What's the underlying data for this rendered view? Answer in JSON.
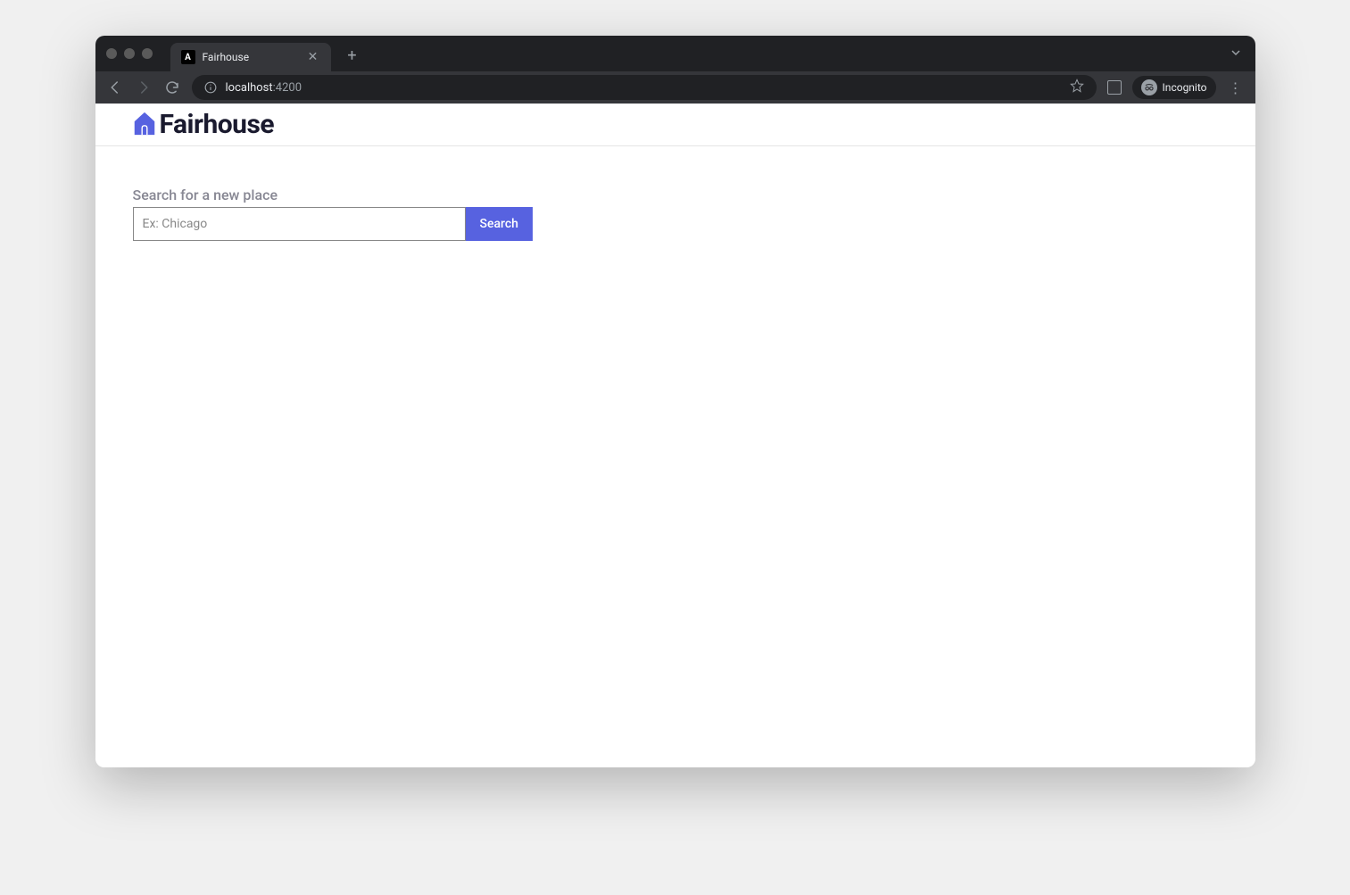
{
  "browser": {
    "tab": {
      "title": "Fairhouse",
      "favicon_letter": "A"
    },
    "url": {
      "host": "localhost",
      "port": ":4200"
    },
    "incognito_label": "Incognito"
  },
  "app": {
    "brand": "Fairhouse",
    "colors": {
      "primary": "#5762e0"
    }
  },
  "search": {
    "label": "Search for a new place",
    "placeholder": "Ex: Chicago",
    "value": "",
    "button_label": "Search"
  }
}
